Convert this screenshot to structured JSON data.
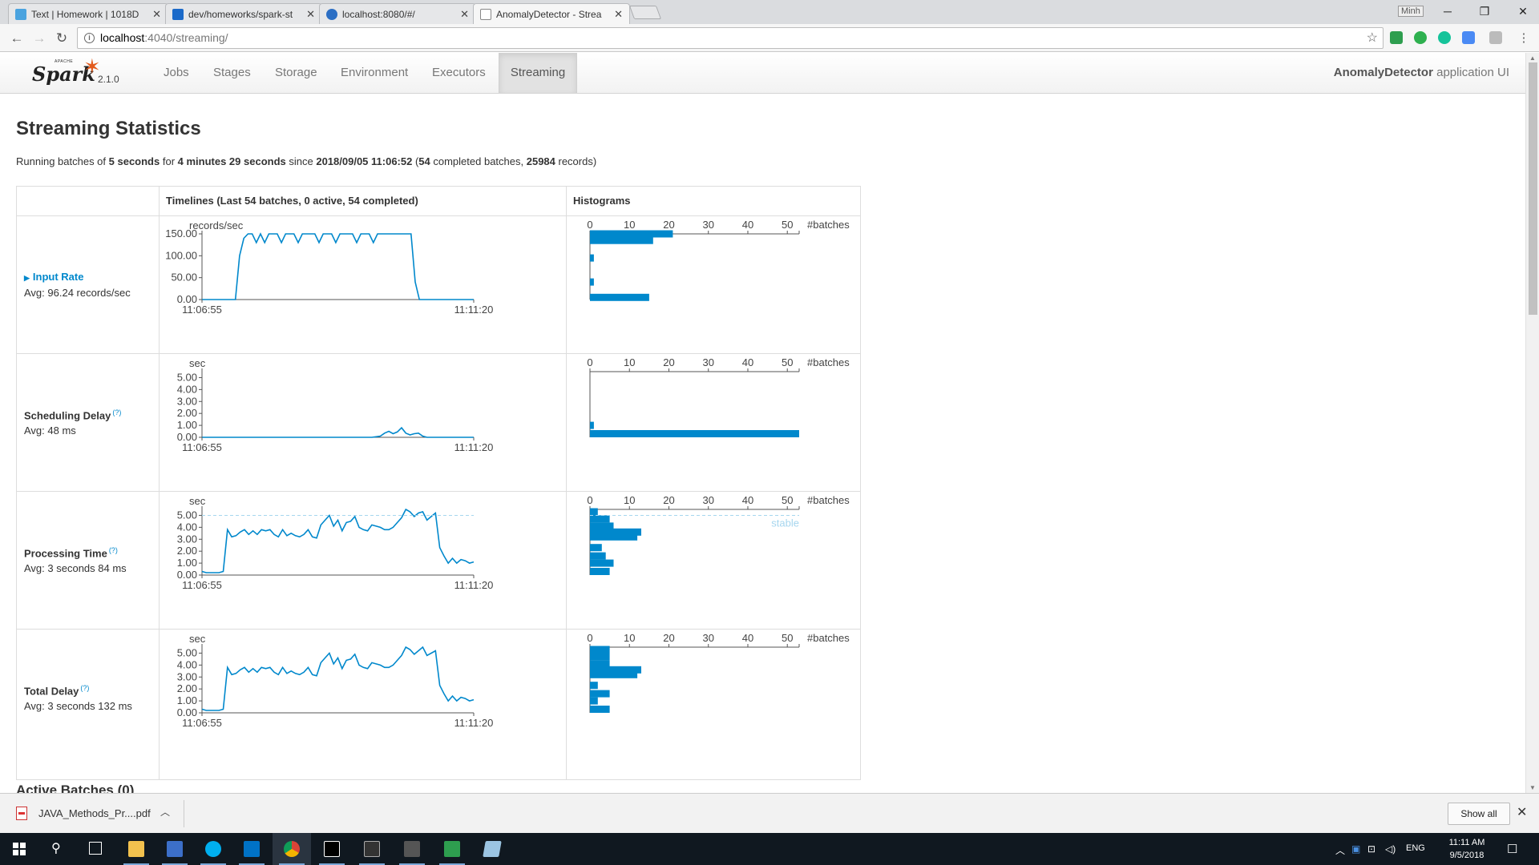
{
  "browser": {
    "tabs": [
      {
        "title": "Text | Homework | 1018D",
        "icon": "classroom-icon",
        "color": "#4aa3df"
      },
      {
        "title": "dev/homeworks/spark-st",
        "icon": "vsts-icon",
        "color": "#1b6ac9"
      },
      {
        "title": "localhost:8080/#/",
        "icon": "globe-icon",
        "color": "#2c6fc4"
      },
      {
        "title": "AnomalyDetector - Strea",
        "icon": "page-icon",
        "color": "#888888"
      }
    ],
    "user_badge": "Minh",
    "url_host": "localhost",
    "url_path": ":4040/streaming/"
  },
  "spark": {
    "version": "2.1.0",
    "apache_label": "APACHE",
    "logo_text": "Spark",
    "nav": [
      "Jobs",
      "Stages",
      "Storage",
      "Environment",
      "Executors",
      "Streaming"
    ],
    "active_nav": "Streaming",
    "app_name": "AnomalyDetector",
    "app_suffix": " application UI"
  },
  "page": {
    "title": "Streaming Statistics",
    "summary": {
      "prefix": "Running batches of ",
      "interval": "5 seconds",
      "for": " for ",
      "duration": "4 minutes 29 seconds",
      "since": " since ",
      "start": "2018/09/05 11:06:52",
      "open": " (",
      "completed": "54",
      "completed_label": " completed batches, ",
      "records": "25984",
      "records_label": " records)"
    },
    "table_headers": {
      "timelines": "Timelines (Last 54 batches, 0 active, 54 completed)",
      "histograms": "Histograms"
    },
    "next_section": "Active Batches (0)"
  },
  "metrics": [
    {
      "name": "Input Rate",
      "link": true,
      "help": "",
      "avg": "Avg: 96.24 records/sec",
      "unit": "records/sec",
      "ticks": [
        "150.00",
        "100.00",
        "50.00",
        "0.00"
      ],
      "tick_values": [
        150,
        100,
        50,
        0
      ],
      "ymax": 150,
      "x_start": "11:06:55",
      "x_end": "11:11:20",
      "timeline": [
        0,
        0,
        0,
        0,
        0,
        0,
        0,
        0,
        0,
        100,
        140,
        150,
        150,
        130,
        150,
        130,
        150,
        150,
        150,
        130,
        150,
        150,
        150,
        130,
        150,
        150,
        150,
        150,
        130,
        150,
        150,
        150,
        130,
        150,
        150,
        150,
        150,
        130,
        150,
        150,
        150,
        130,
        150,
        150,
        150,
        150,
        150,
        150,
        150,
        150,
        150,
        40,
        0,
        0,
        0,
        0,
        0,
        0,
        0,
        0,
        0,
        0,
        0,
        0,
        0,
        0
      ],
      "histogram": [
        {
          "v": 150,
          "count": 21
        },
        {
          "v": 135,
          "count": 16
        },
        {
          "v": 95,
          "count": 1
        },
        {
          "v": 40,
          "count": 1
        },
        {
          "v": 5,
          "count": 15
        }
      ],
      "hist_range": [
        0,
        150
      ],
      "stable": null
    },
    {
      "name": "Scheduling Delay",
      "link": false,
      "help": "(?)",
      "avg": "Avg: 48 ms",
      "unit": "sec",
      "ticks": [
        "5.00",
        "4.00",
        "3.00",
        "2.00",
        "1.00",
        "0.00"
      ],
      "tick_values": [
        5,
        4,
        3,
        2,
        1,
        0
      ],
      "ymax": 5.5,
      "x_start": "11:06:55",
      "x_end": "11:11:20",
      "timeline": [
        0,
        0,
        0,
        0,
        0,
        0,
        0,
        0,
        0,
        0,
        0,
        0,
        0,
        0,
        0,
        0,
        0,
        0,
        0,
        0,
        0,
        0,
        0,
        0,
        0,
        0,
        0,
        0,
        0,
        0,
        0,
        0,
        0,
        0,
        0,
        0,
        0,
        0,
        0,
        0,
        0,
        0.05,
        0.1,
        0.35,
        0.5,
        0.3,
        0.45,
        0.8,
        0.35,
        0.2,
        0.3,
        0.35,
        0.1,
        0,
        0,
        0,
        0,
        0,
        0,
        0,
        0,
        0,
        0,
        0,
        0
      ],
      "histogram": [
        {
          "v": 1.0,
          "count": 1
        },
        {
          "v": 0.3,
          "count": 53
        }
      ],
      "hist_range": [
        0,
        5.5
      ],
      "stable": null
    },
    {
      "name": "Processing Time",
      "link": false,
      "help": "(?)",
      "avg": "Avg: 3 seconds 84 ms",
      "unit": "sec",
      "ticks": [
        "5.00",
        "4.00",
        "3.00",
        "2.00",
        "1.00",
        "0.00"
      ],
      "tick_values": [
        5,
        4,
        3,
        2,
        1,
        0
      ],
      "ymax": 5.5,
      "x_start": "11:06:55",
      "x_end": "11:11:20",
      "timeline": [
        0.3,
        0.2,
        0.2,
        0.2,
        0.2,
        0.3,
        3.8,
        3.2,
        3.3,
        3.6,
        3.8,
        3.4,
        3.7,
        3.4,
        3.8,
        3.7,
        3.8,
        3.4,
        3.2,
        3.8,
        3.3,
        3.5,
        3.3,
        3.2,
        3.4,
        3.8,
        3.2,
        3.1,
        4.2,
        4.6,
        5.0,
        4.1,
        4.6,
        3.7,
        4.4,
        4.5,
        4.9,
        4.0,
        3.8,
        3.7,
        4.2,
        4.1,
        4.0,
        3.8,
        3.8,
        4.0,
        4.4,
        4.8,
        5.6,
        5.3,
        4.9,
        5.2,
        5.3,
        4.6,
        4.9,
        5.2,
        2.3,
        1.6,
        1.0,
        1.4,
        1.0,
        1.3,
        1.2,
        1.0,
        1.1
      ],
      "histogram": [
        {
          "v": 5.3,
          "count": 2
        },
        {
          "v": 4.7,
          "count": 5
        },
        {
          "v": 4.1,
          "count": 6
        },
        {
          "v": 3.6,
          "count": 13
        },
        {
          "v": 3.2,
          "count": 12
        },
        {
          "v": 2.3,
          "count": 3
        },
        {
          "v": 1.6,
          "count": 4
        },
        {
          "v": 1.0,
          "count": 6
        },
        {
          "v": 0.3,
          "count": 5
        }
      ],
      "hist_range": [
        0,
        5.5
      ],
      "stable": {
        "value": 5,
        "label": "stable"
      }
    },
    {
      "name": "Total Delay",
      "link": false,
      "help": "(?)",
      "avg": "Avg: 3 seconds 132 ms",
      "unit": "sec",
      "ticks": [
        "5.00",
        "4.00",
        "3.00",
        "2.00",
        "1.00",
        "0.00"
      ],
      "tick_values": [
        5,
        4,
        3,
        2,
        1,
        0
      ],
      "ymax": 5.5,
      "x_start": "11:06:55",
      "x_end": "11:11:20",
      "timeline": [
        0.3,
        0.2,
        0.2,
        0.2,
        0.2,
        0.3,
        3.8,
        3.2,
        3.3,
        3.6,
        3.8,
        3.4,
        3.7,
        3.4,
        3.8,
        3.7,
        3.8,
        3.4,
        3.2,
        3.8,
        3.3,
        3.5,
        3.3,
        3.2,
        3.4,
        3.8,
        3.2,
        3.1,
        4.2,
        4.6,
        5.0,
        4.1,
        4.6,
        3.7,
        4.4,
        4.5,
        4.9,
        4.0,
        3.8,
        3.7,
        4.2,
        4.1,
        4.0,
        3.8,
        3.8,
        4.0,
        4.4,
        4.8,
        5.6,
        5.3,
        4.9,
        5.2,
        5.5,
        4.8,
        5.0,
        5.2,
        2.3,
        1.6,
        1.0,
        1.4,
        1.0,
        1.3,
        1.2,
        1.0,
        1.1
      ],
      "histogram": [
        {
          "v": 5.3,
          "count": 5
        },
        {
          "v": 4.7,
          "count": 5
        },
        {
          "v": 4.1,
          "count": 5
        },
        {
          "v": 3.6,
          "count": 13
        },
        {
          "v": 3.2,
          "count": 12
        },
        {
          "v": 2.3,
          "count": 2
        },
        {
          "v": 1.6,
          "count": 5
        },
        {
          "v": 1.0,
          "count": 2
        },
        {
          "v": 0.3,
          "count": 5
        }
      ],
      "hist_range": [
        0,
        5.5
      ],
      "stable": null
    }
  ],
  "histogram_axis": {
    "ticks": [
      "0",
      "10",
      "20",
      "30",
      "40",
      "50"
    ],
    "tick_values": [
      0,
      10,
      20,
      30,
      40,
      50
    ],
    "label": "#batches"
  },
  "downloads": {
    "file": "JAVA_Methods_Pr....pdf",
    "show_all": "Show all"
  },
  "taskbar": {
    "lang": "ENG",
    "time": "11:11 AM",
    "date": "9/5/2018"
  },
  "colors": {
    "series": "#0088cc",
    "stable": "#a6d6ef",
    "spark_orange": "#e25a1c"
  }
}
